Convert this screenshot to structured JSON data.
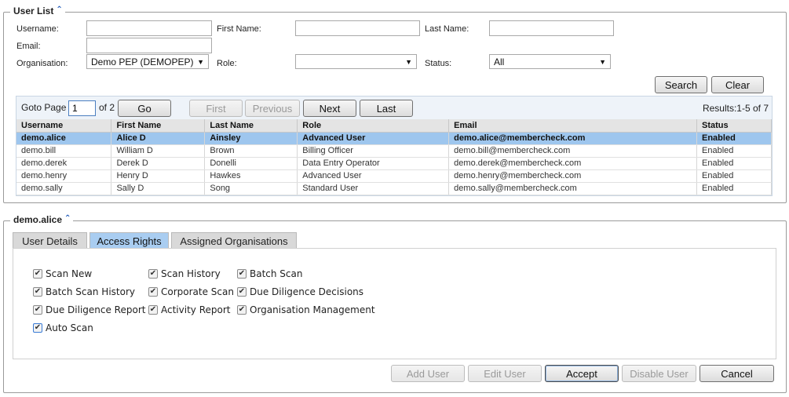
{
  "user_list": {
    "title": "User List",
    "collapse_icon": "double-chevron-up-icon",
    "filters": {
      "username_label": "Username:",
      "username_value": "",
      "firstname_label": "First Name:",
      "firstname_value": "",
      "lastname_label": "Last Name:",
      "lastname_value": "",
      "email_label": "Email:",
      "email_value": "",
      "organisation_label": "Organisation:",
      "organisation_value": "Demo PEP (DEMOPEP)",
      "role_label": "Role:",
      "role_value": "",
      "status_label": "Status:",
      "status_value": "All"
    },
    "search_label": "Search",
    "clear_label": "Clear",
    "pager": {
      "goto_label": "Goto Page",
      "page_value": "1",
      "of_label": "of 2",
      "go_label": "Go",
      "first_label": "First",
      "previous_label": "Previous",
      "next_label": "Next",
      "last_label": "Last",
      "results_label": "Results:1-5 of 7"
    },
    "columns": [
      "Username",
      "First Name",
      "Last Name",
      "Role",
      "Email",
      "Status"
    ],
    "rows": [
      [
        "demo.alice",
        "Alice D",
        "Ainsley",
        "Advanced User",
        "demo.alice@membercheck.com",
        "Enabled"
      ],
      [
        "demo.bill",
        "William D",
        "Brown",
        "Billing Officer",
        "demo.bill@membercheck.com",
        "Enabled"
      ],
      [
        "demo.derek",
        "Derek D",
        "Donelli",
        "Data Entry Operator",
        "demo.derek@membercheck.com",
        "Enabled"
      ],
      [
        "demo.henry",
        "Henry D",
        "Hawkes",
        "Advanced User",
        "demo.henry@membercheck.com",
        "Enabled"
      ],
      [
        "demo.sally",
        "Sally D",
        "Song",
        "Standard User",
        "demo.sally@membercheck.com",
        "Enabled"
      ]
    ],
    "selected_row": 0
  },
  "detail": {
    "title": "demo.alice",
    "tabs": [
      {
        "label": "User Details"
      },
      {
        "label": "Access Rights"
      },
      {
        "label": "Assigned Organisations"
      }
    ],
    "active_tab": 1,
    "rights": [
      {
        "label": "Scan New",
        "checked": true
      },
      {
        "label": "Scan History",
        "checked": true
      },
      {
        "label": "Batch Scan",
        "checked": true
      },
      {
        "label": "Batch Scan History",
        "checked": true
      },
      {
        "label": "Corporate Scan",
        "checked": true
      },
      {
        "label": "Due Diligence Decisions",
        "checked": true
      },
      {
        "label": "Due Diligence Report",
        "checked": true
      },
      {
        "label": "Activity Report",
        "checked": true
      },
      {
        "label": "Organisation Management",
        "checked": true
      },
      {
        "label": "Auto Scan",
        "checked": true
      }
    ],
    "buttons": {
      "add_user": "Add User",
      "edit_user": "Edit User",
      "accept": "Accept",
      "disable_user": "Disable User",
      "cancel": "Cancel"
    }
  },
  "colors": {
    "selected_row": "#9ec6ee",
    "active_tab": "#a9cdf1",
    "chevron": "#1a56b8"
  }
}
